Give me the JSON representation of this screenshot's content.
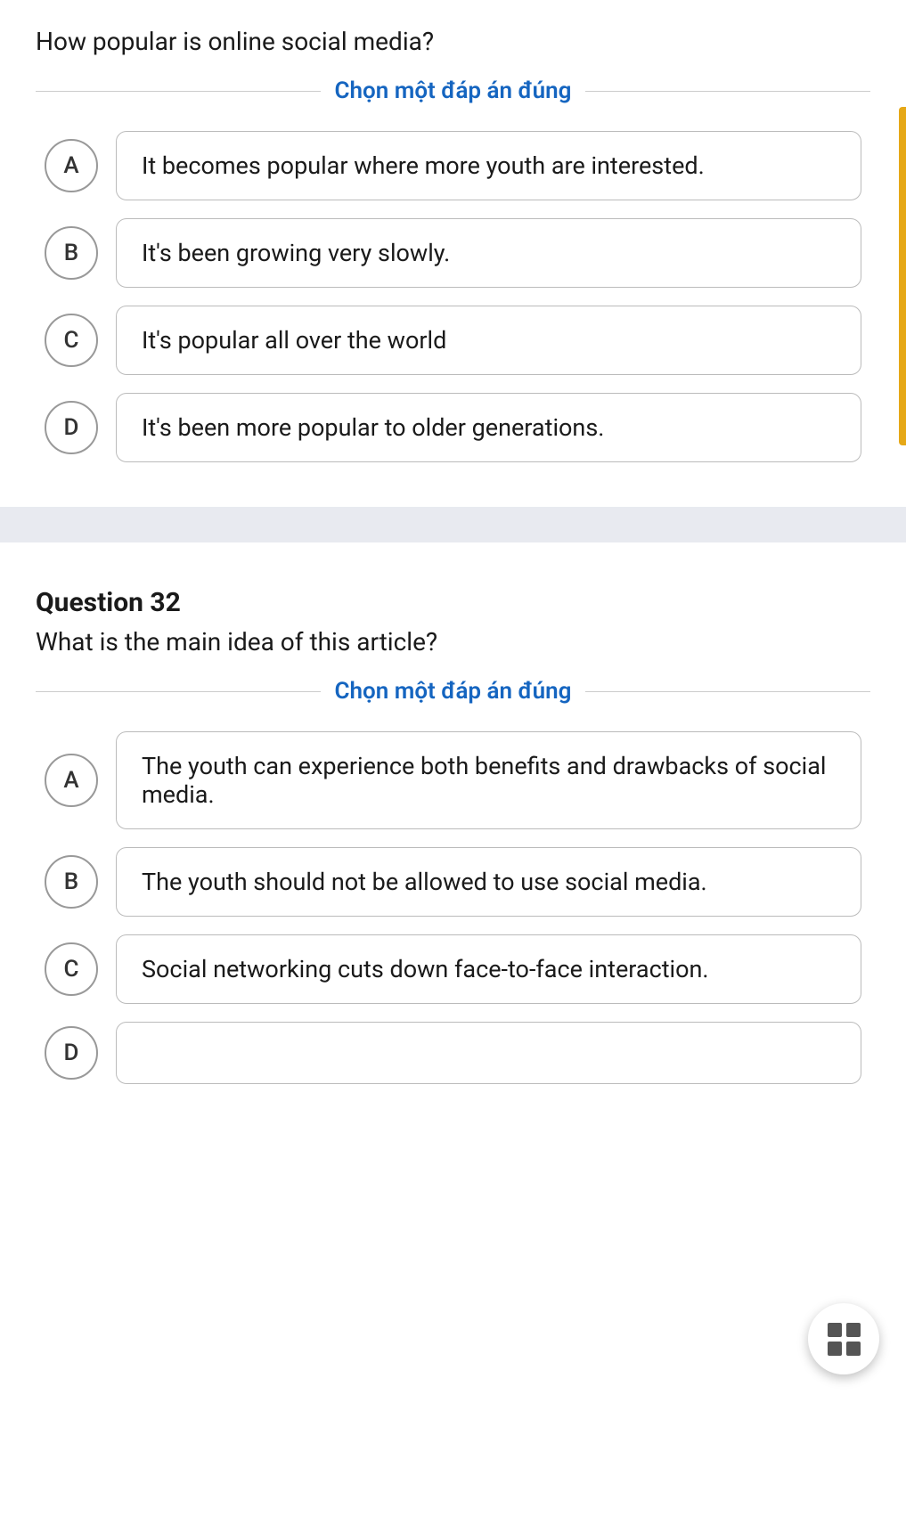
{
  "page": {
    "question31": {
      "label": "",
      "text": "How popular is online social media?",
      "divider": "Chọn một đáp án đúng",
      "options": [
        {
          "id": "A",
          "text": "It becomes popular where more youth are interested."
        },
        {
          "id": "B",
          "text": "It's been growing very slowly."
        },
        {
          "id": "C",
          "text": "It's popular all over the world"
        },
        {
          "id": "D",
          "text": "It's been more popular to older generations."
        }
      ]
    },
    "question32": {
      "label": "Question 32",
      "text": "What is the main idea of this article?",
      "divider": "Chọn một đáp án đúng",
      "options": [
        {
          "id": "A",
          "text": "The youth can experience both benefits and drawbacks of social media."
        },
        {
          "id": "B",
          "text": "The youth should not be allowed to use social media."
        },
        {
          "id": "C",
          "text": "Social networking cuts down face-to-face interaction."
        },
        {
          "id": "D",
          "text": ""
        }
      ]
    },
    "fab": {
      "icon": "grid-icon"
    }
  }
}
